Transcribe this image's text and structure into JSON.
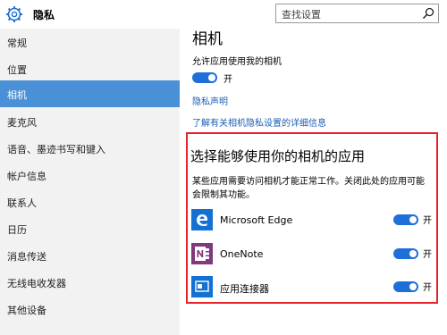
{
  "header": {
    "title": "隐私",
    "search_placeholder": "查找设置"
  },
  "sidebar": {
    "items": [
      {
        "label": "常规",
        "selected": false
      },
      {
        "label": "位置",
        "selected": false
      },
      {
        "label": "相机",
        "selected": true
      },
      {
        "label": "麦克风",
        "selected": false
      },
      {
        "label": "语音、墨迹书写和键入",
        "selected": false
      },
      {
        "label": "帐户信息",
        "selected": false
      },
      {
        "label": "联系人",
        "selected": false
      },
      {
        "label": "日历",
        "selected": false
      },
      {
        "label": "消息传送",
        "selected": false
      },
      {
        "label": "无线电收发器",
        "selected": false
      },
      {
        "label": "其他设备",
        "selected": false
      }
    ]
  },
  "main": {
    "title": "相机",
    "allow_label": "允许应用使用我的相机",
    "allow_toggle_state": "开",
    "privacy_link": "隐私声明",
    "details_link": "了解有关相机隐私设置的详细信息",
    "apps_section_title": "选择能够使用你的相机的应用",
    "apps_description": "某些应用需要访问相机才能正常工作。关闭此处的应用可能会限制其功能。",
    "apps": [
      {
        "name": "Microsoft Edge",
        "icon": "edge-icon",
        "state": "开"
      },
      {
        "name": "OneNote",
        "icon": "onenote-icon",
        "state": "开"
      },
      {
        "name": "应用连接器",
        "icon": "app-connector-icon",
        "state": "开"
      }
    ]
  },
  "colors": {
    "accent": "#1f6fd8",
    "selected_nav": "#4a90d6",
    "highlight_box": "#e8232a"
  }
}
